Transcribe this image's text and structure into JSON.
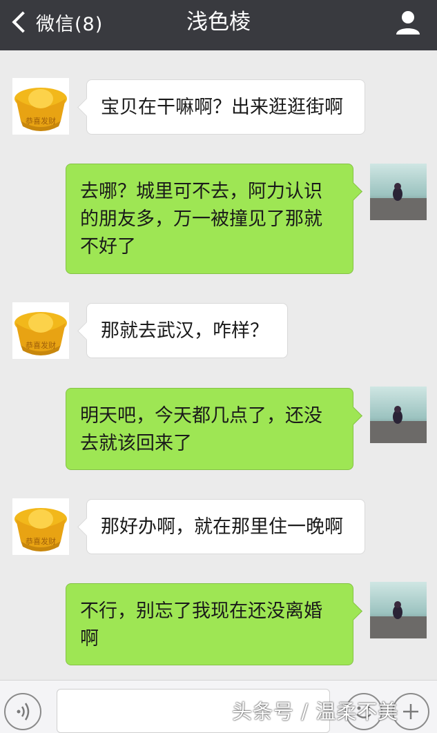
{
  "header": {
    "back_label": "微信(8)",
    "title": "浅色棱",
    "icons": {
      "back": "chevron-left-icon",
      "profile": "person-icon"
    }
  },
  "messages": [
    {
      "direction": "in",
      "text": "宝贝在干嘛啊？出来逛逛街啊",
      "avatar_text": "恭喜发财"
    },
    {
      "direction": "out",
      "text_lines": [
        "去哪？城里可不去，阿力认识",
        "的朋友多，万一被撞见了那就",
        "不好了"
      ]
    },
    {
      "direction": "in",
      "text": "那就去武汉，咋样？",
      "avatar_text": "恭喜发财"
    },
    {
      "direction": "out",
      "text_lines": [
        "明天吧，今天都几点了，还没",
        "去就该回来了"
      ]
    },
    {
      "direction": "in",
      "text": "那好办啊，就在那里住一晚啊",
      "avatar_text": "恭喜发财"
    },
    {
      "direction": "out",
      "text_lines": [
        "不行，别忘了我现在还没离婚",
        "啊"
      ]
    }
  ],
  "composer": {
    "input_value": "",
    "icons": {
      "voice": "voice-icon",
      "emoji": "emoji-icon",
      "more": "plus-icon"
    }
  },
  "watermark": "头条号 / 温柔不美",
  "colors": {
    "topbar": "#393a3f",
    "background": "#ebebeb",
    "outgoing_bubble": "#9ee654",
    "incoming_bubble": "#ffffff"
  }
}
